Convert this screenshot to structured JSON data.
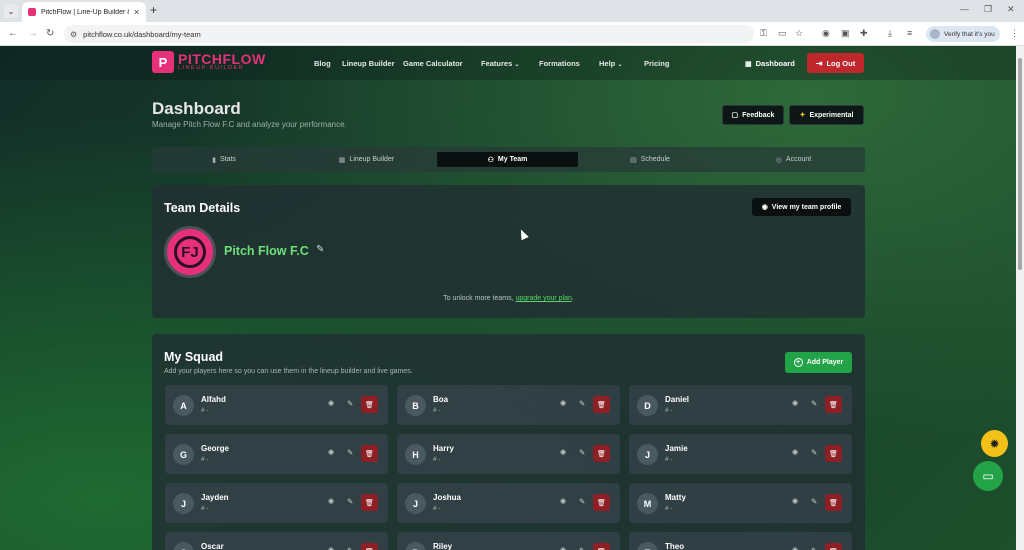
{
  "browser": {
    "tab_title": "PitchFlow | Line-Up Builder & T",
    "url": "pitchflow.co.uk/dashboard/my-team",
    "verify_chip": "Verify that it's you"
  },
  "logo": {
    "mark": "P",
    "name": "PITCHFLOW",
    "sub": "LINEUP BUILDER"
  },
  "nav": {
    "blog": "Blog",
    "lineup_builder": "Lineup Builder",
    "game_calculator": "Game Calculator",
    "features": "Features",
    "formations": "Formations",
    "help": "Help",
    "pricing": "Pricing",
    "dashboard": "Dashboard",
    "logout": "Log Out"
  },
  "page": {
    "title": "Dashboard",
    "subtitle": "Manage Pitch Flow F.C and analyze your performance.",
    "feedback": "Feedback",
    "experimental": "Experimental"
  },
  "tabs": {
    "stats": "Stats",
    "lineup_builder": "Lineup Builder",
    "my_team": "My Team",
    "schedule": "Schedule",
    "account": "Account"
  },
  "team": {
    "heading": "Team Details",
    "view_profile": "View my team profile",
    "avatar_letters": "FJ",
    "name": "Pitch Flow F.C",
    "unlock_prefix": "To unlock more teams, ",
    "upgrade_link": "upgrade your plan",
    "unlock_suffix": "."
  },
  "squad": {
    "heading": "My Squad",
    "subtitle": "Add your players here so you can use them in the lineup builder and live games.",
    "add_player": "Add Player",
    "players": [
      {
        "initial": "A",
        "name": "Alfahd",
        "number": "# -"
      },
      {
        "initial": "B",
        "name": "Boa",
        "number": "# -"
      },
      {
        "initial": "D",
        "name": "Daniel",
        "number": "# -"
      },
      {
        "initial": "G",
        "name": "George",
        "number": "# -"
      },
      {
        "initial": "H",
        "name": "Harry",
        "number": "# -"
      },
      {
        "initial": "J",
        "name": "Jamie",
        "number": "# -"
      },
      {
        "initial": "J",
        "name": "Jayden",
        "number": "# -"
      },
      {
        "initial": "J",
        "name": "Joshua",
        "number": "# -"
      },
      {
        "initial": "M",
        "name": "Matty",
        "number": "# -"
      },
      {
        "initial": "O",
        "name": "Oscar",
        "number": ""
      },
      {
        "initial": "R",
        "name": "Riley",
        "number": ""
      },
      {
        "initial": "T",
        "name": "Theo",
        "number": ""
      }
    ]
  },
  "colors": {
    "brand_pink": "#e6307a",
    "logout_red": "#c0272d",
    "add_green": "#23a347",
    "team_name_green": "#6fe07a",
    "bug_yellow": "#f2c21a"
  },
  "icons": {
    "stats": "bar-chart-icon",
    "lineup": "grid-icon",
    "team": "users-icon",
    "schedule": "calendar-icon",
    "account": "user-circle-icon",
    "view": "eye-icon",
    "edit": "pencil-icon",
    "delete": "trash-icon"
  }
}
